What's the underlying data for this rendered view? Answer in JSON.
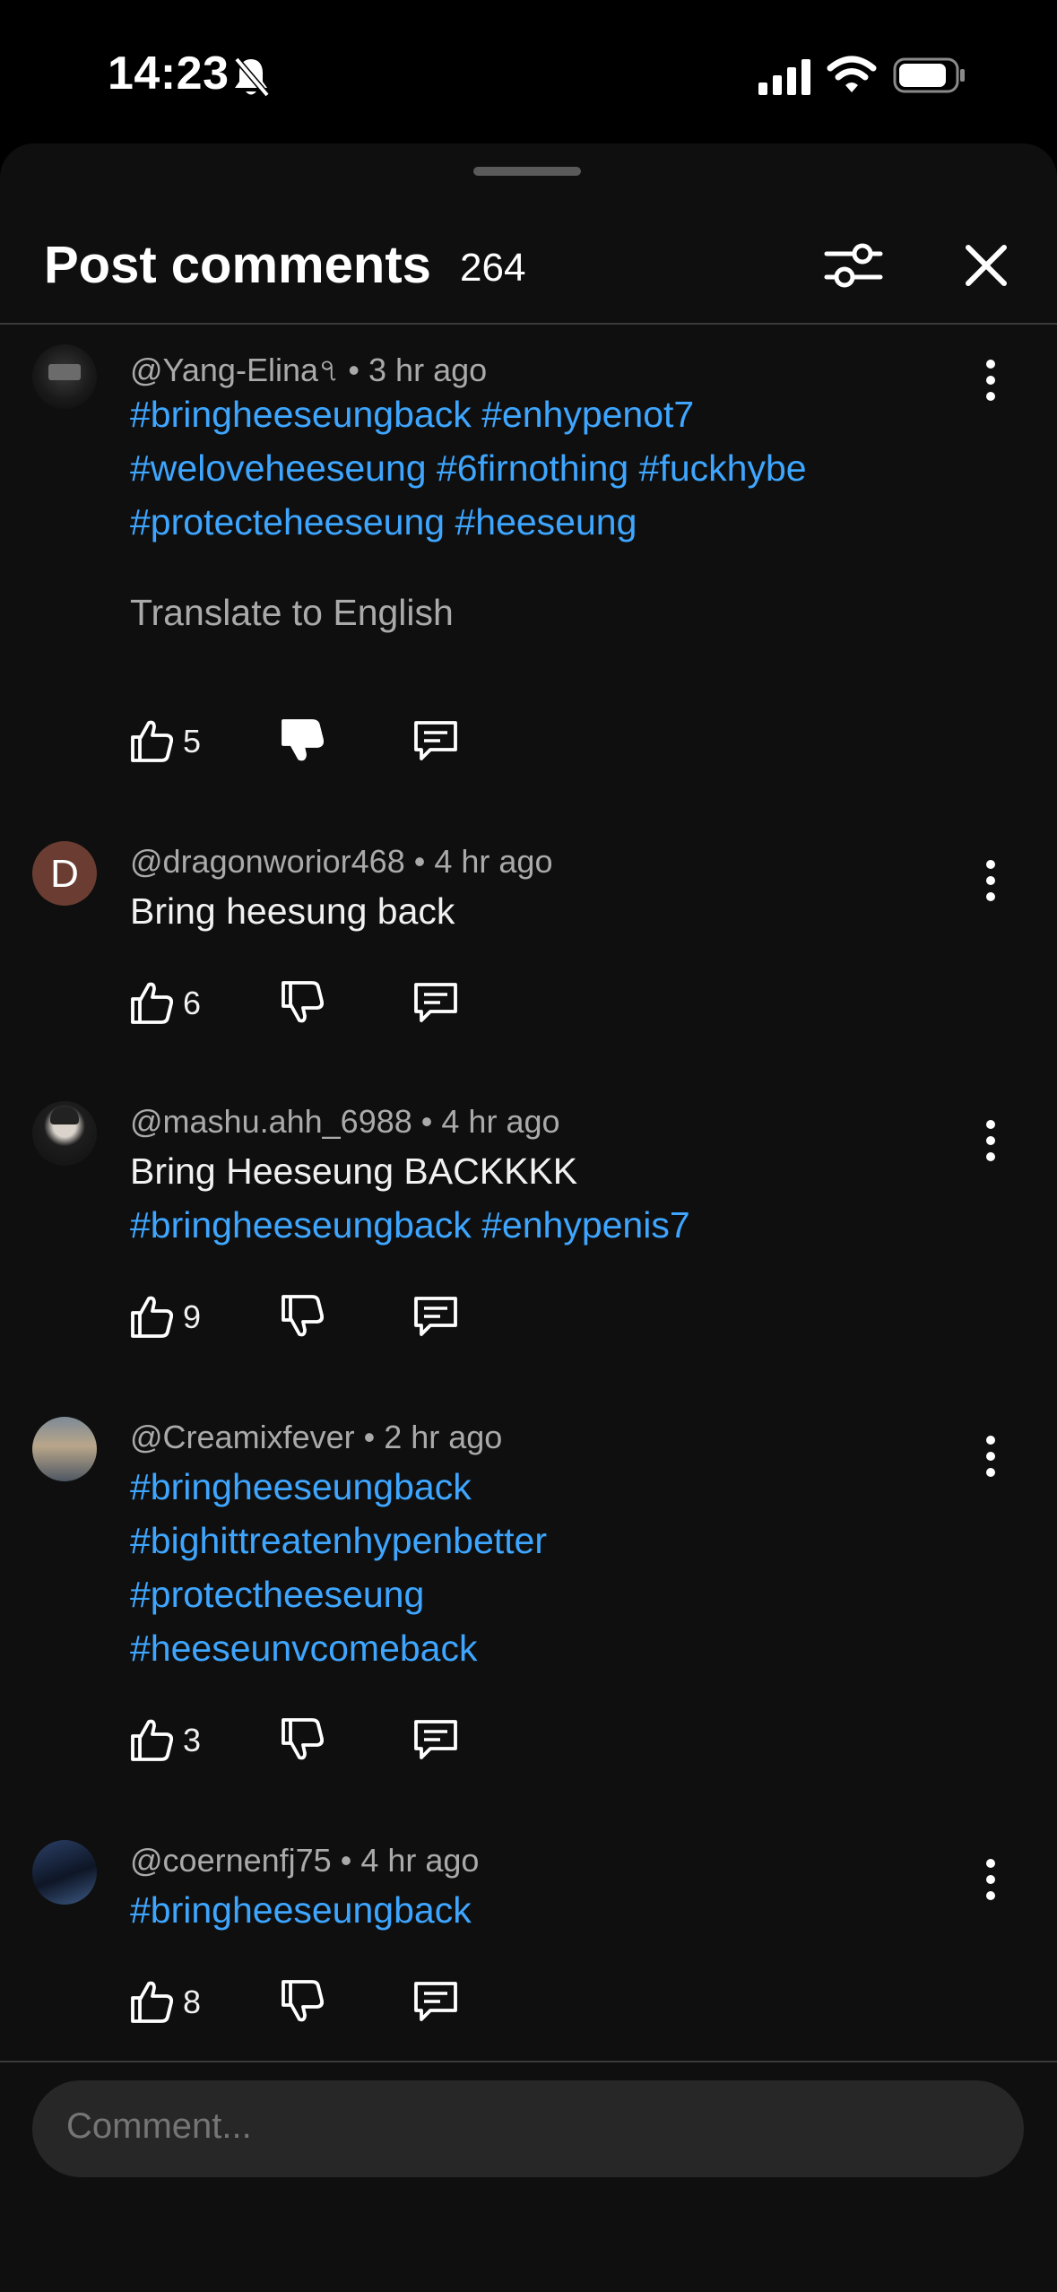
{
  "status_bar": {
    "time": "14:23"
  },
  "header": {
    "title": "Post comments",
    "count": "264"
  },
  "comments": [
    {
      "handle": "@Yang-Elina৭",
      "time": "3 hr ago",
      "lines": [
        [
          "#bringheeseungback",
          "#enhypenot7"
        ],
        [
          "#weloveheeseung",
          "#6firnothing",
          "#fuckhybe"
        ],
        [
          "#protecteheeseung",
          "#heeseung"
        ]
      ],
      "translate": "Translate to English",
      "likes": "5",
      "disliked": true
    },
    {
      "handle": "@dragonworior468",
      "time": "4 hr ago",
      "avatar_letter": "D",
      "text": "Bring heesung back",
      "likes": "6"
    },
    {
      "handle": "@mashu.ahh_6988",
      "time": "4 hr ago",
      "text": "Bring Heeseung BACKKKK",
      "lines": [
        [
          "#bringheeseungback",
          "#enhypenis7"
        ]
      ],
      "likes": "9"
    },
    {
      "handle": "@Creamixfever",
      "time": "2 hr ago",
      "lines": [
        [
          "#bringheeseungback"
        ],
        [
          "#bighittreatenhypenbetter"
        ],
        [
          "#protectheeseung"
        ],
        [
          "#heeseunvcomeback"
        ]
      ],
      "likes": "3"
    },
    {
      "handle": "@coernenfj75",
      "time": "4 hr ago",
      "lines": [
        [
          "#bringheeseungback"
        ]
      ],
      "likes": "8"
    }
  ],
  "composer": {
    "placeholder": "Comment..."
  },
  "colors": {
    "hashtag": "#3ea6ff",
    "background": "#0f0f0f"
  },
  "icons": {
    "like": "thumbs-up-icon",
    "dislike": "thumbs-down-icon",
    "reply": "comment-icon",
    "more": "more-vertical-icon",
    "filter": "sliders-icon",
    "close": "close-icon"
  }
}
